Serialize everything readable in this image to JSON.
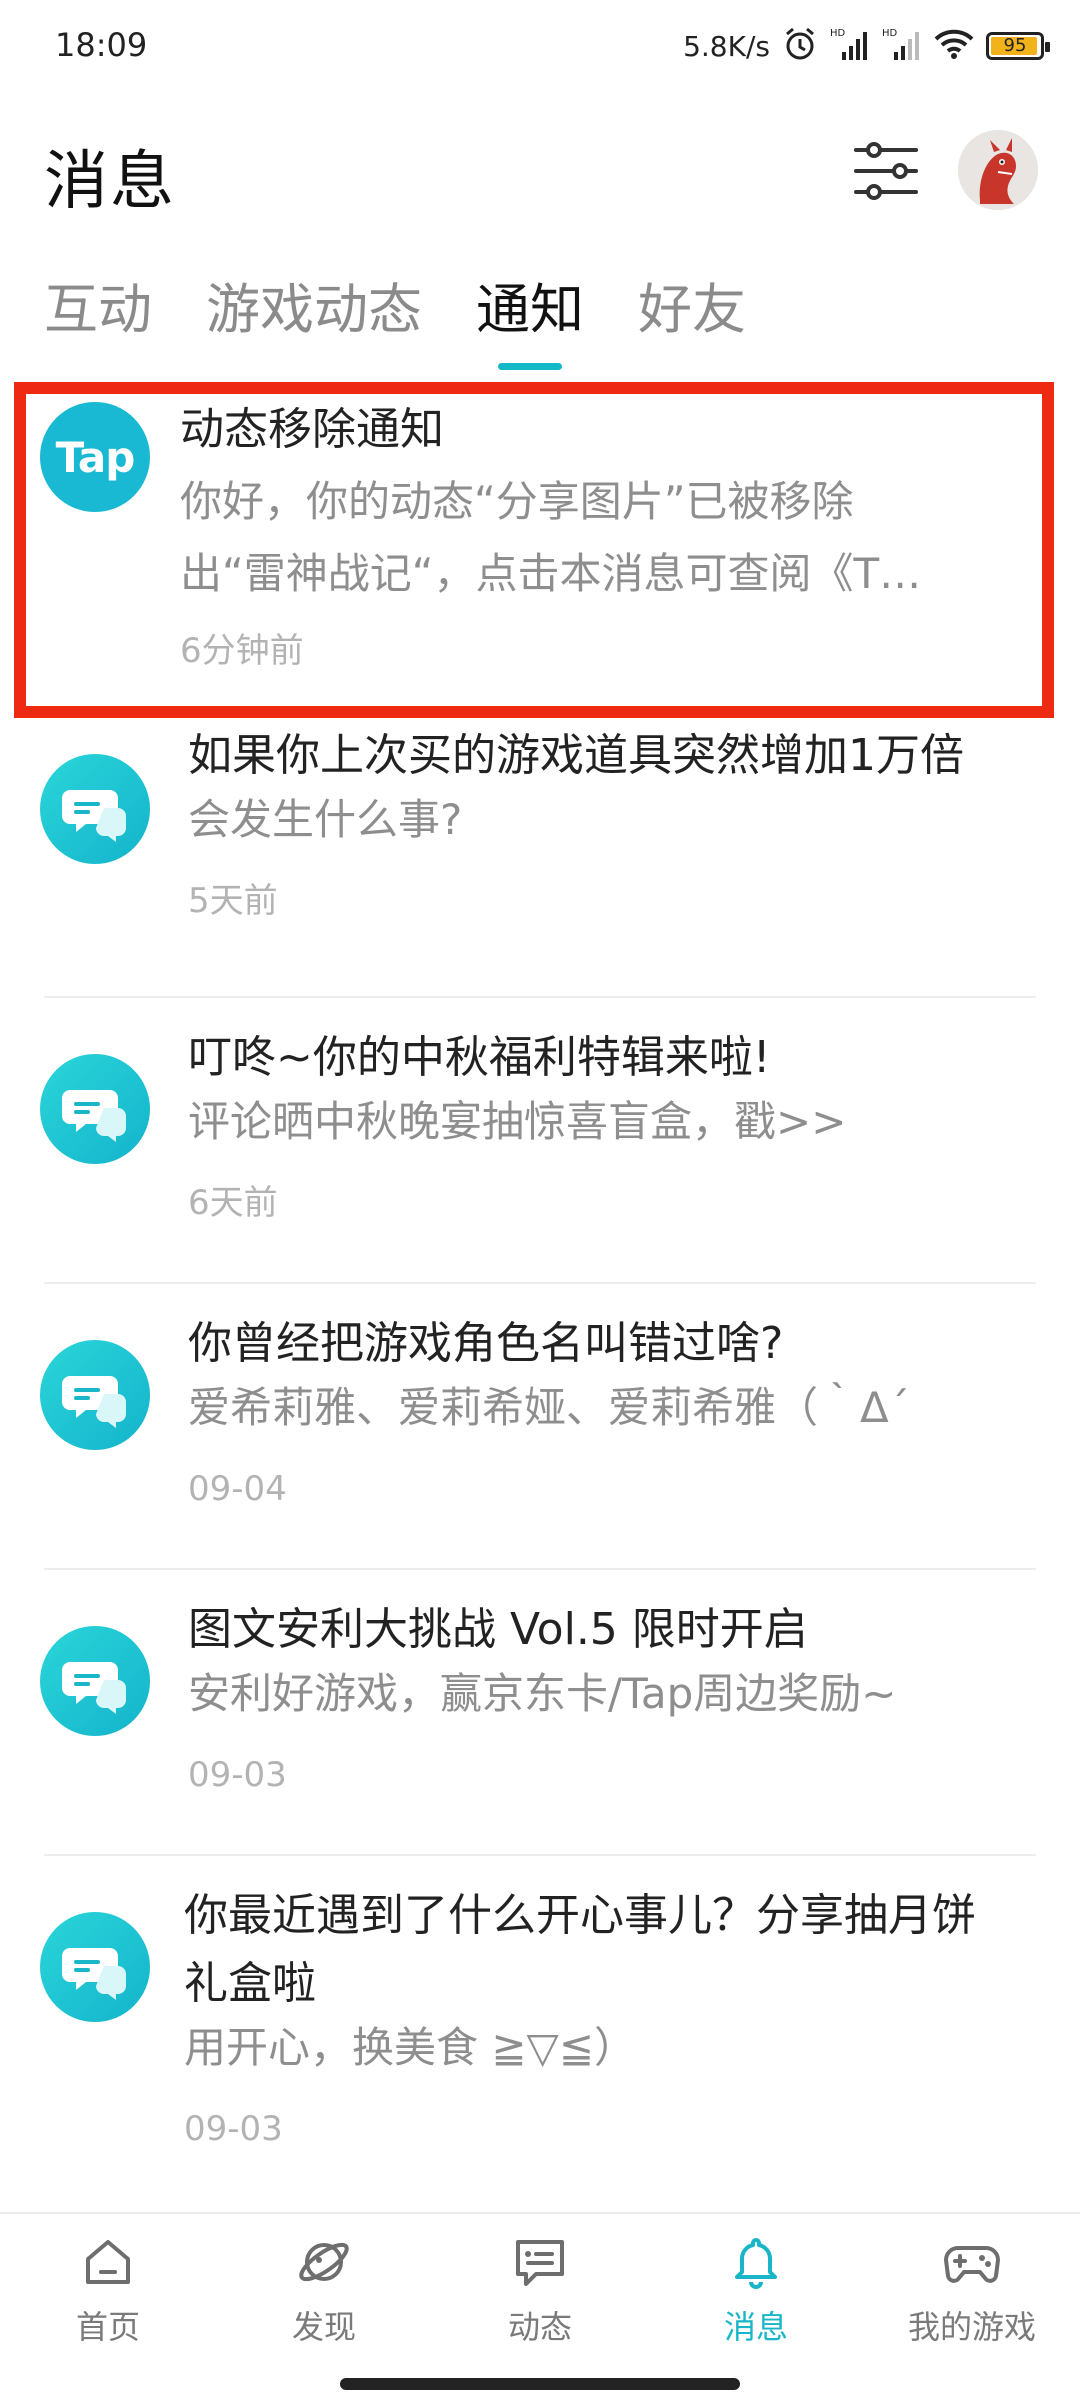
{
  "status": {
    "time": "18:09",
    "net_speed": "5.8K/s",
    "battery": "95",
    "icons": [
      "alarm-icon",
      "hd-signal-icon",
      "hd-signal-icon",
      "wifi-icon",
      "battery-icon"
    ]
  },
  "header": {
    "title": "消息",
    "filter_icon": "sliders-icon",
    "avatar": "avatar"
  },
  "tabs": [
    {
      "label": "互动"
    },
    {
      "label": "游戏动态"
    },
    {
      "label": "通知",
      "active": true
    },
    {
      "label": "好友"
    }
  ],
  "items": [
    {
      "icon": "tap-logo",
      "icon_text": "Tap",
      "title": "动态移除通知",
      "desc1": "你好，你的动态“分享图片”已被移除",
      "desc2": "出“雷神战记“，点击本消息可查阅《T…",
      "time": "6分钟前"
    },
    {
      "icon": "chat-bubble-icon",
      "title": "如果你上次买的游戏道具突然增加1万倍",
      "desc": "会发生什么事?",
      "time": "5天前"
    },
    {
      "icon": "chat-bubble-icon",
      "title": "叮咚~你的中秋福利特辑来啦!",
      "desc": "评论晒中秋晚宴抽惊喜盲盒，戳>>",
      "time": "6天前"
    },
    {
      "icon": "chat-bubble-icon",
      "title": "你曾经把游戏角色名叫错过啥?",
      "desc": "爱希莉雅、爱莉希娅、爱莉希雅（｀Δ´",
      "time": "09-04"
    },
    {
      "icon": "chat-bubble-icon",
      "title": "图文安利大挑战 Vol.5 限时开启",
      "desc": "安利好游戏，赢京东卡/Tap周边奖励~",
      "time": "09-03"
    },
    {
      "icon": "chat-bubble-icon",
      "title1": "你最近遇到了什么开心事儿？分享抽月饼",
      "title2": "礼盒啦",
      "desc": "用开心，换美食 ≧▽≦）",
      "time": "09-03"
    }
  ],
  "nav": [
    {
      "label": "首页",
      "icon": "home-icon"
    },
    {
      "label": "发现",
      "icon": "planet-icon"
    },
    {
      "label": "动态",
      "icon": "message-square-icon"
    },
    {
      "label": "消息",
      "icon": "bell-icon",
      "active": true
    },
    {
      "label": "我的游戏",
      "icon": "gamepad-icon"
    }
  ],
  "colors": {
    "accent": "#19b6c7",
    "highlight": "#ee2a12"
  }
}
